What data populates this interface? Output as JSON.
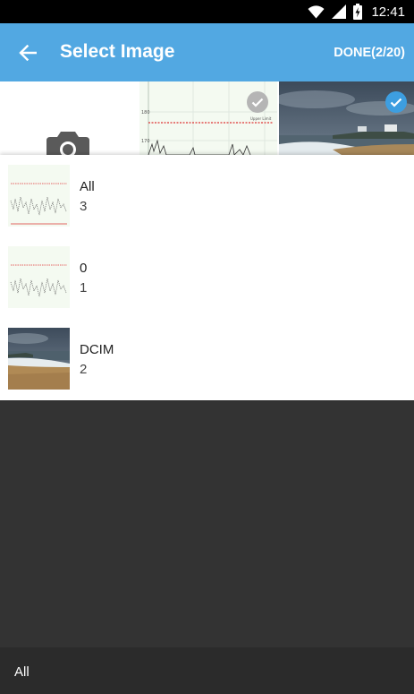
{
  "status_bar": {
    "time": "12:41",
    "icons": [
      "wifi-icon",
      "cell-signal-icon",
      "battery-charging-icon"
    ]
  },
  "app_bar": {
    "title": "Select Image",
    "done_label": "DONE(2/20)",
    "back_icon": "arrow-left-icon",
    "color": "#52a8e2"
  },
  "grid": {
    "tiles": [
      {
        "kind": "camera",
        "icon": "camera-icon"
      },
      {
        "kind": "chart-thumbnail",
        "selected": true,
        "check_color": "#b5b5b5",
        "axis_labels": [
          "180",
          "170"
        ],
        "legend_text": "Upper Limit"
      },
      {
        "kind": "beach-photo",
        "selected": true,
        "check_color": "#3d9ee0"
      }
    ]
  },
  "folders": [
    {
      "name": "All",
      "count": "3",
      "thumb": "chart"
    },
    {
      "name": "0",
      "count": "1",
      "thumb": "chart"
    },
    {
      "name": "DCIM",
      "count": "2",
      "thumb": "beach"
    }
  ],
  "bottom_bar": {
    "label": "All"
  },
  "colors": {
    "overlay": "#333333",
    "bottom_bar": "#2b2b2b",
    "accent": "#3d9ee0"
  }
}
